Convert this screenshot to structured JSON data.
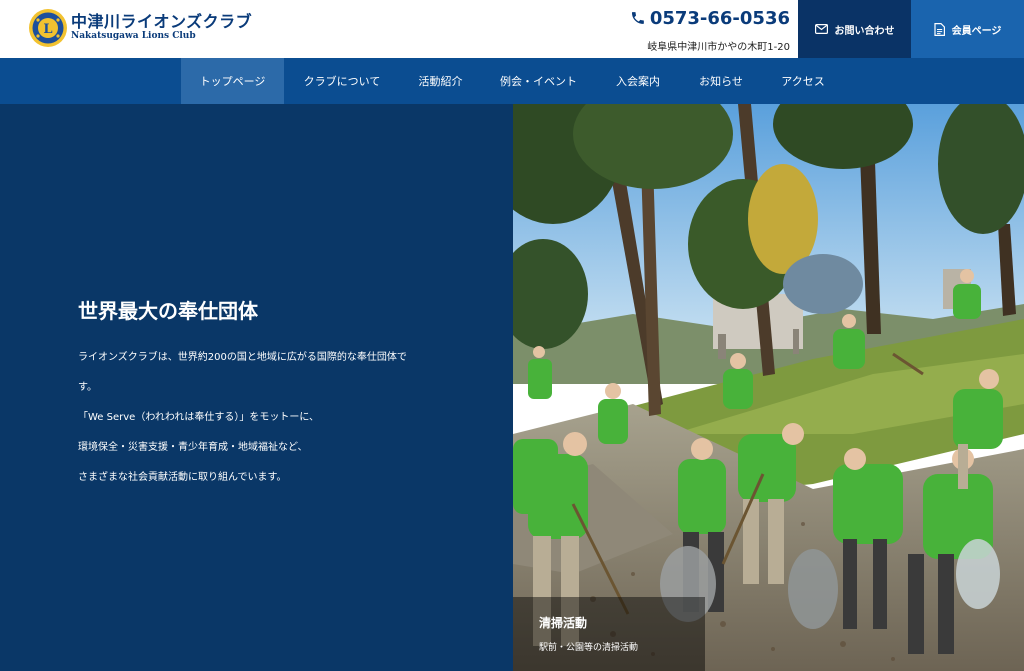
{
  "header": {
    "brand_jp": "中津川ライオンズクラブ",
    "brand_en": "Nakatsugawa Lions Club",
    "logo_icon": "lions-emblem-icon",
    "phone": "0573-66-0536",
    "address": "岐阜県中津川市かやの木町1-20",
    "inquiry_label": "お問い合わせ",
    "member_label": "会員ページ"
  },
  "nav": {
    "items": [
      {
        "label": "トップページ",
        "active": true
      },
      {
        "label": "クラブについて"
      },
      {
        "label": "活動紹介"
      },
      {
        "label": "例会・イベント"
      },
      {
        "label": "入会案内"
      },
      {
        "label": "お知らせ"
      },
      {
        "label": "アクセス"
      }
    ]
  },
  "hero": {
    "title": "世界最大の奉仕団体",
    "lines": [
      "ライオンズクラブは、世界約200の国と地域に広がる国際的な奉仕団体で",
      "す。",
      "「We Serve（われわれは奉仕する）」をモットーに、",
      "環境保全・災害支援・青少年育成・地域福祉など、",
      "さまざまな社会貢献活動に取り組んでいます。"
    ],
    "caption_title": "清掃活動",
    "caption_sub": "駅前・公園等の清掃活動"
  },
  "colors": {
    "navy": "#0a3767",
    "nav_blue": "#0b4d91",
    "nav_active": "#2c6aa9",
    "inquiry_bg": "#0a3366",
    "member_bg": "#1a64ae",
    "brand_text": "#0a3b7a"
  }
}
